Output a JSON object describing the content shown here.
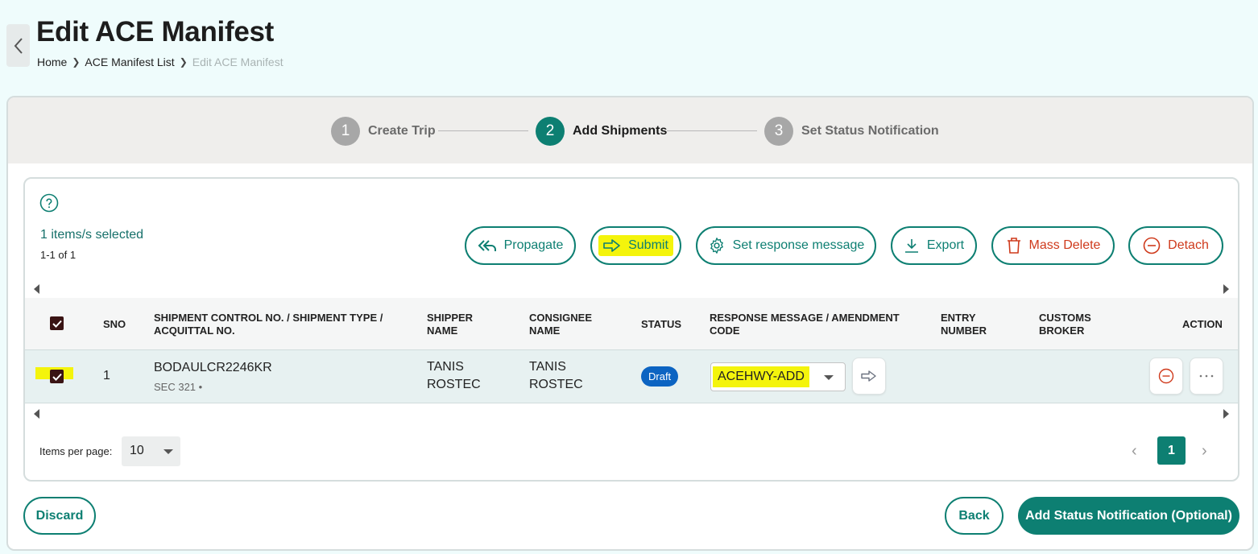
{
  "header": {
    "title": "Edit ACE Manifest",
    "breadcrumb": [
      "Home",
      "ACE Manifest List",
      "Edit ACE Manifest"
    ]
  },
  "stepper": {
    "steps": [
      {
        "num": "1",
        "label": "Create Trip",
        "state": "complete"
      },
      {
        "num": "2",
        "label": "Add Shipments",
        "state": "active"
      },
      {
        "num": "3",
        "label": "Set Status Notification",
        "state": "pending"
      }
    ]
  },
  "toolbar": {
    "selected_text": "1 items/s selected",
    "range_text": "1-1 of 1",
    "buttons": {
      "propagate": "Propagate",
      "submit": "Submit",
      "set_response": "Set response message",
      "export": "Export",
      "mass_delete": "Mass Delete",
      "detach": "Detach"
    }
  },
  "table": {
    "columns": {
      "sno": "SNO",
      "shipment": "SHIPMENT CONTROL NO. / SHIPMENT TYPE / ACQUITTAL NO.",
      "shipper": "SHIPPER NAME",
      "consignee": "CONSIGNEE NAME",
      "status": "STATUS",
      "response": "RESPONSE MESSAGE / AMENDMENT CODE",
      "entry": "ENTRY NUMBER",
      "broker": "CUSTOMS BROKER",
      "action": "ACTION"
    },
    "rows": [
      {
        "checked": true,
        "sno": "1",
        "shipment_control_no": "BODAULCR2246KR",
        "shipment_type": "SEC 321 •",
        "shipper_name": "TANIS ROSTEC",
        "consignee_name": "TANIS ROSTEC",
        "status": "Draft",
        "response_code": "ACEHWY-ADD",
        "entry_number": "",
        "customs_broker": ""
      }
    ]
  },
  "pagination": {
    "items_per_page_label": "Items per page:",
    "items_per_page": "10",
    "current_page": "1"
  },
  "footer": {
    "discard": "Discard",
    "back": "Back",
    "next": "Add Status Notification (Optional)"
  },
  "colors": {
    "primary": "#0d7f72",
    "danger": "#cf3a1c",
    "highlight": "#f4f40c",
    "status_draft": "#0c64c2"
  },
  "icons": [
    "chevron-left-icon",
    "help-circle-icon",
    "reply-all-icon",
    "arrow-right-icon",
    "gear-icon",
    "download-icon",
    "trash-icon",
    "minus-circle-icon",
    "more-horizontal-icon",
    "caret-down-icon"
  ]
}
